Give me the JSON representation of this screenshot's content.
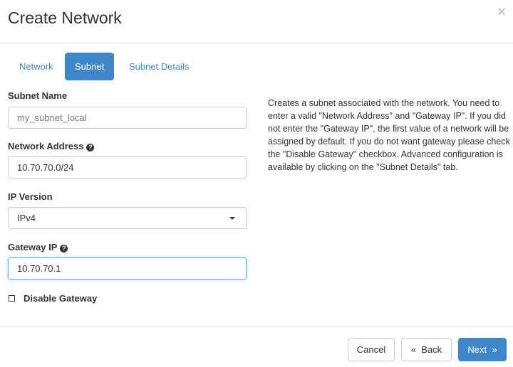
{
  "modal": {
    "title": "Create Network",
    "close_icon": "×"
  },
  "tabs": [
    {
      "label": "Network",
      "active": false
    },
    {
      "label": "Subnet",
      "active": true
    },
    {
      "label": "Subnet Details",
      "active": false
    }
  ],
  "form": {
    "subnet_name": {
      "label": "Subnet Name",
      "value": "",
      "placeholder": "my_subnet_local"
    },
    "network_address": {
      "label": "Network Address",
      "value": "10.70.70.0/24",
      "help_icon": "question-circle"
    },
    "ip_version": {
      "label": "IP Version",
      "value": "IPv4"
    },
    "gateway_ip": {
      "label": "Gateway IP",
      "value": "10.70.70.1",
      "help_icon": "question-circle"
    },
    "disable_gateway": {
      "label": "Disable Gateway",
      "checked": false
    }
  },
  "help_text": "Creates a subnet associated with the network. You need to enter a valid \"Network Address\" and \"Gateway IP\". If you did not enter the \"Gateway IP\", the first value of a network will be assigned by default. If you do not want gateway please check the \"Disable Gateway\" checkbox. Advanced configuration is available by clicking on the \"Subnet Details\" tab.",
  "footer": {
    "cancel": "Cancel",
    "back": "«  Back",
    "next": "Next  »"
  },
  "colors": {
    "primary": "#3f87c8"
  }
}
